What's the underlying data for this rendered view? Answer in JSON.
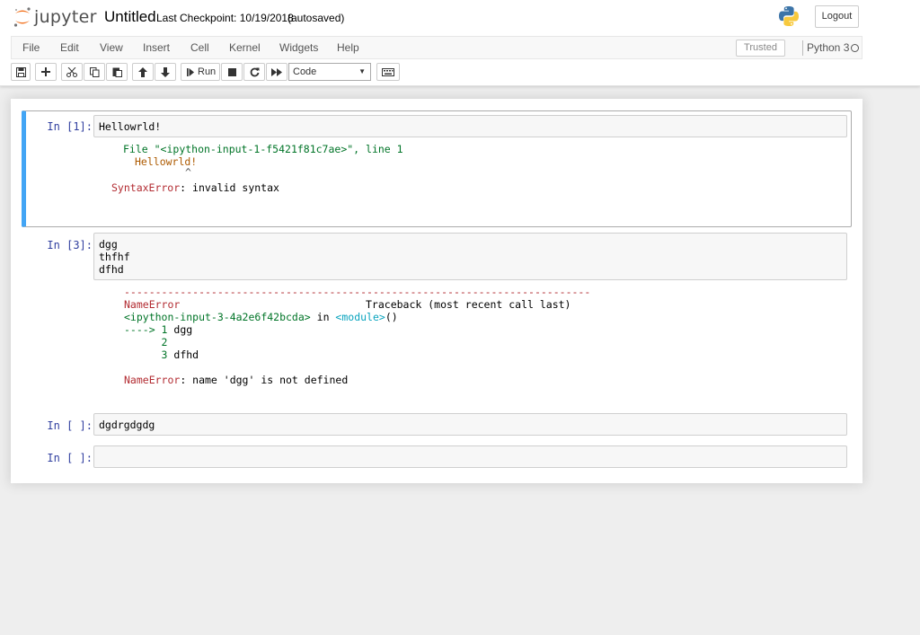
{
  "header": {
    "logo_text": "jupyter",
    "notebook_title": "Untitled",
    "checkpoint": "Last Checkpoint: 10/19/2018",
    "autosaved": "(autosaved)",
    "logout_label": "Logout"
  },
  "menu": {
    "items": [
      "File",
      "Edit",
      "View",
      "Insert",
      "Cell",
      "Kernel",
      "Widgets",
      "Help"
    ],
    "trusted": "Trusted",
    "kernel": "Python 3"
  },
  "toolbar": {
    "run_label": "Run",
    "cell_type": "Code",
    "icons": [
      "save-icon",
      "plus-icon",
      "cut-icon",
      "copy-icon",
      "paste-icon",
      "arrow-up-icon",
      "arrow-down-icon",
      "run-icon",
      "stop-icon",
      "restart-icon",
      "fast-forward-icon",
      "keyboard-icon"
    ]
  },
  "cells": [
    {
      "prompt": "In [1]:",
      "input": "Hellowrld!",
      "output": {
        "file_line_a": "File ",
        "file_line_b": "\"<ipython-input-1-f5421f81c7ae>\", line 1",
        "code_line": "Hellowrld!",
        "caret": "^",
        "error_name": "SyntaxError",
        "error_msg": ": invalid syntax"
      }
    },
    {
      "prompt": "In [3]:",
      "input": "dgg\nthfhf\ndfhd",
      "output": {
        "dashes": "---------------------------------------------------------------------------",
        "error_name": "NameError",
        "traceback": "Traceback (most recent call last)",
        "location": "<ipython-input-3-4a2e6f42bcda>",
        "in_word": " in ",
        "module": "<module>",
        "parens": "()",
        "arrow": "----> 1 ",
        "line1": "dgg",
        "num2": "      2",
        "num3": "      3 ",
        "line3": "dfhd",
        "error_msg": ": name 'dgg' is not defined"
      }
    },
    {
      "prompt": "In [ ]:",
      "input": "dgdrgdgdg"
    },
    {
      "prompt": "In [ ]:",
      "input": ""
    }
  ],
  "colors": {
    "selected_border": "#42a5f5",
    "prompt": "#303f9f",
    "error": "#b22b31",
    "green": "#007427",
    "orange": "#ad5a00",
    "logo_orange": "#f37726"
  }
}
